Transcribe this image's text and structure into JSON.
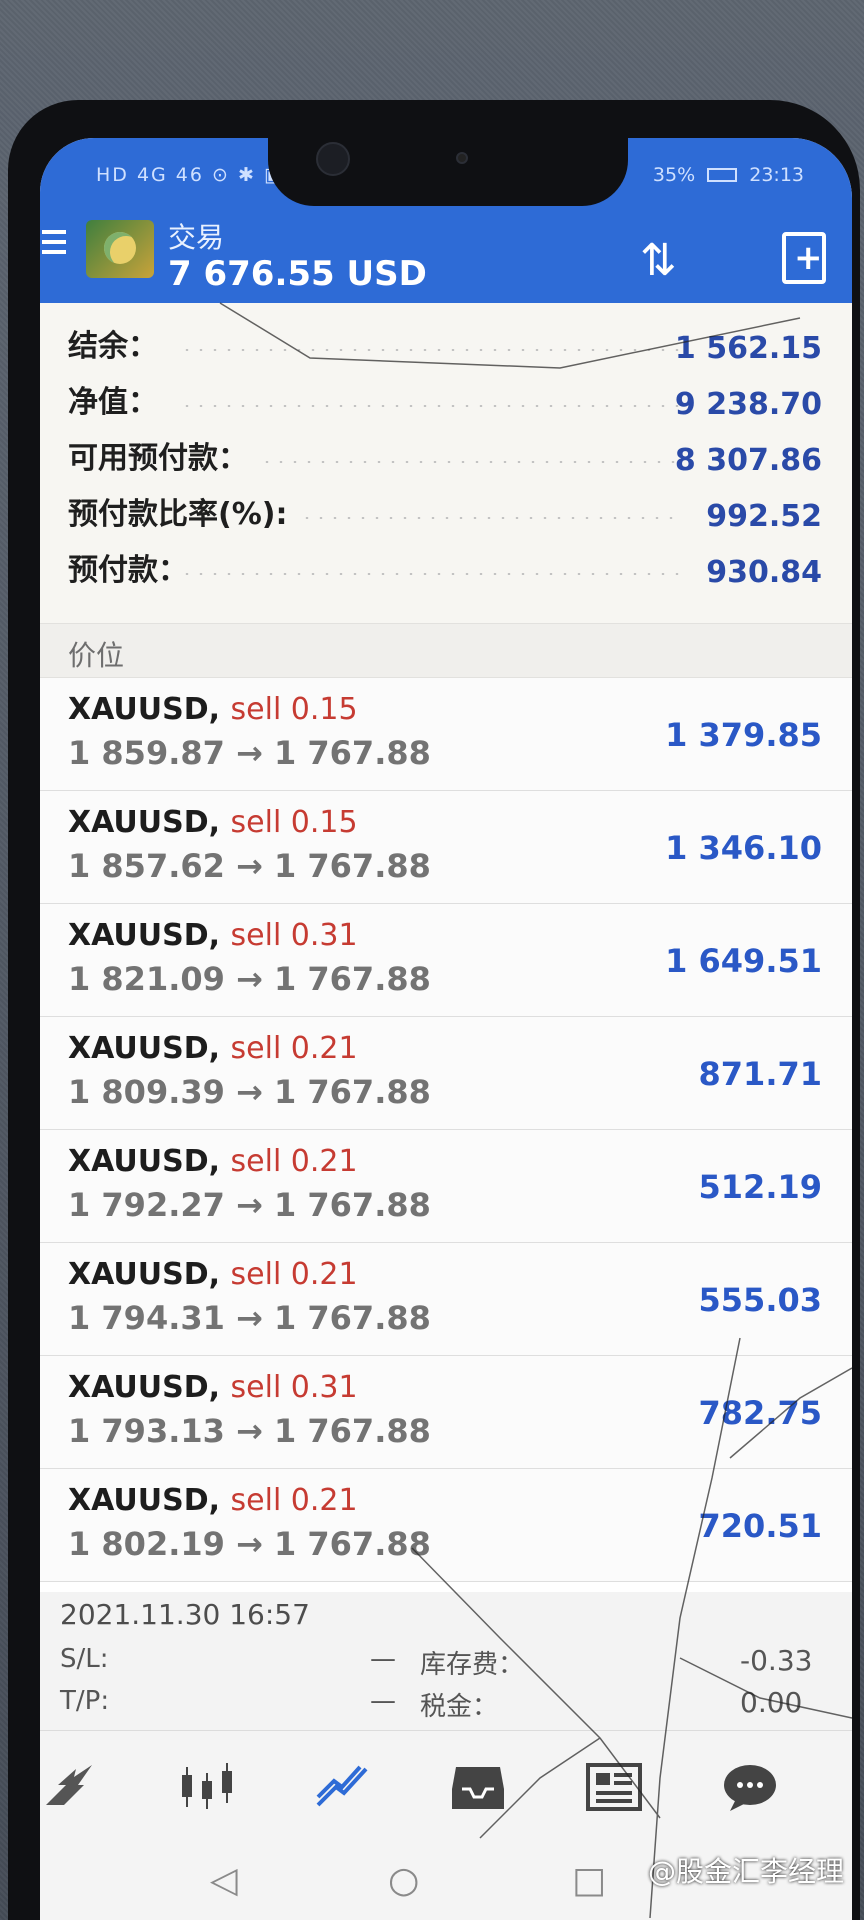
{
  "status_bar": {
    "left": "HD 4G 46 ⊙ ✱ ▣",
    "battery": "35%",
    "time": "23:13"
  },
  "header": {
    "title": "交易",
    "balance": "7 676.55 USD"
  },
  "account": [
    {
      "label": "结余：",
      "value": "1 562.15"
    },
    {
      "label": "净值：",
      "value": "9 238.70"
    },
    {
      "label": "可用预付款：",
      "value": "8 307.86"
    },
    {
      "label": "预付款比率(%):",
      "value": "992.52"
    },
    {
      "label": "预付款：",
      "value": "930.84"
    }
  ],
  "section_label": "价位",
  "positions": [
    {
      "symbol": "XAUUSD,",
      "side": "sell 0.15",
      "prices": "1 859.87 → 1 767.88",
      "profit": "1 379.85"
    },
    {
      "symbol": "XAUUSD,",
      "side": "sell 0.15",
      "prices": "1 857.62 → 1 767.88",
      "profit": "1 346.10"
    },
    {
      "symbol": "XAUUSD,",
      "side": "sell 0.31",
      "prices": "1 821.09 → 1 767.88",
      "profit": "1 649.51"
    },
    {
      "symbol": "XAUUSD,",
      "side": "sell 0.21",
      "prices": "1 809.39 → 1 767.88",
      "profit": "871.71"
    },
    {
      "symbol": "XAUUSD,",
      "side": "sell 0.21",
      "prices": "1 792.27 → 1 767.88",
      "profit": "512.19"
    },
    {
      "symbol": "XAUUSD,",
      "side": "sell 0.21",
      "prices": "1 794.31 → 1 767.88",
      "profit": "555.03"
    },
    {
      "symbol": "XAUUSD,",
      "side": "sell 0.31",
      "prices": "1 793.13 → 1 767.88",
      "profit": "782.75"
    },
    {
      "symbol": "XAUUSD,",
      "side": "sell 0.21",
      "prices": "1 802.19 → 1 767.88",
      "profit": "720.51"
    }
  ],
  "detail": {
    "time": "2021.11.30 16:57",
    "sl_label": "S/L:",
    "sl_value": "—",
    "tp_label": "T/P:",
    "tp_value": "—",
    "swap_label": "库存费：",
    "swap_value": "-0.33",
    "tax_label": "税金：",
    "tax_value": "0.00"
  },
  "nav": [
    "quotes-icon",
    "chart-icon",
    "trade-icon",
    "history-icon",
    "news-icon",
    "chat-icon"
  ],
  "accent": "#2e6bd6",
  "profit_color": "#2a58c6",
  "sell_color": "#c63b32",
  "watermark": "@股金汇李经理"
}
